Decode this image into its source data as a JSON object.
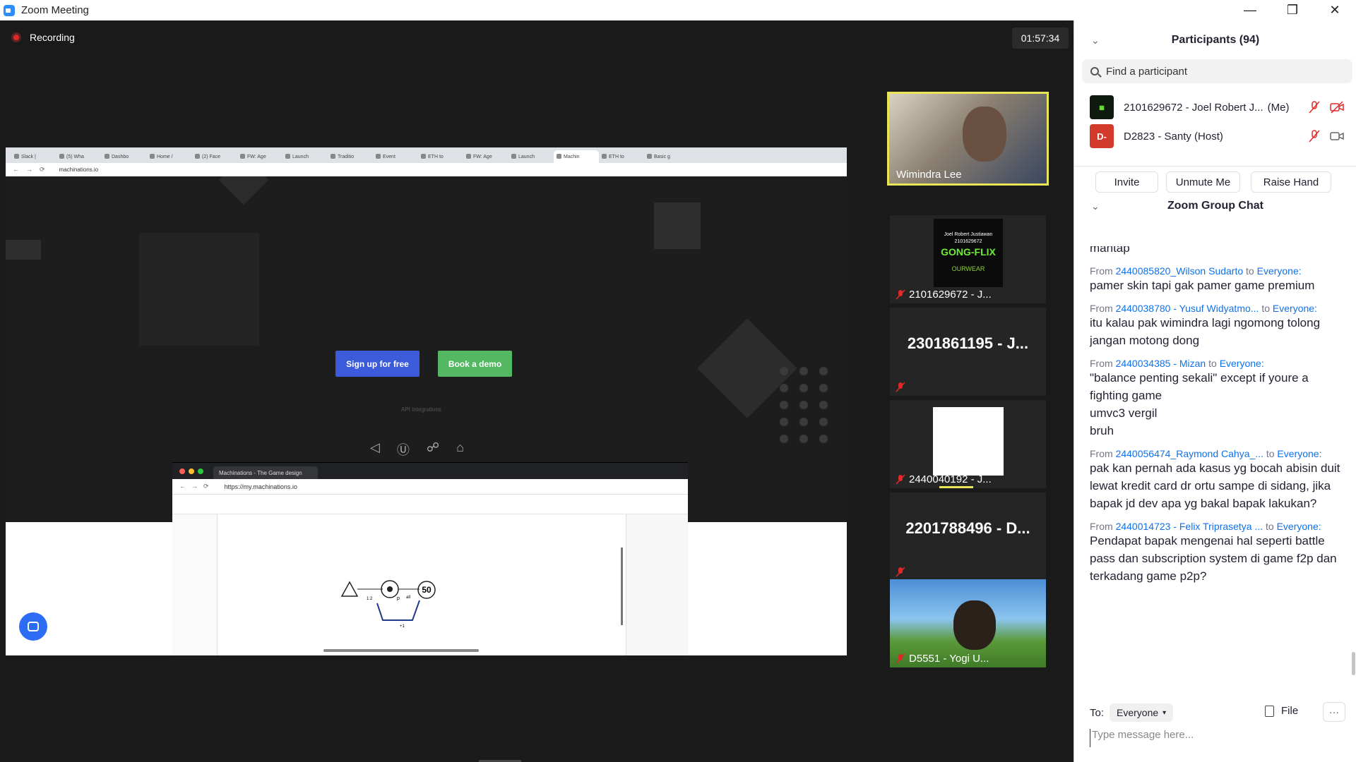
{
  "window": {
    "title": "Zoom Meeting",
    "controls": {
      "minimize": "—",
      "maximize": "❐",
      "close": "✕"
    }
  },
  "meeting": {
    "recording_label": "Recording",
    "timer": "01:57:34"
  },
  "shared_screen": {
    "browser_tabs": [
      "Slack | ",
      "(5) Wha",
      "Dashbo",
      "Home /",
      "(2) Face",
      "FW: Age",
      "Launch",
      "Traditio",
      "Event",
      "ETH to",
      "FW: Age",
      "Launch",
      "Machin",
      "ETH to",
      "Basic g"
    ],
    "url": "machinations.io",
    "signup_button": "Sign up for free",
    "demo_button": "Book a demo",
    "api_label": "API Integrations",
    "inner_window": {
      "tab_title": "Machinations - The Game design",
      "url": "https://my.machinations.io",
      "diagram_value": "50",
      "diagram_labels": [
        "1:2",
        "p",
        "all",
        "+1"
      ]
    }
  },
  "tiles": [
    {
      "name": "Wimindra Lee",
      "active": true,
      "muted": false
    },
    {
      "name": "2101629672 - J...",
      "muted": true,
      "poster": {
        "line1": "Joel Robert Justiawan",
        "line2": "2101629672",
        "brand": "GONG-FLIX",
        "footer": "OURWEAR"
      }
    },
    {
      "name": "2301861195 - J...",
      "muted": true
    },
    {
      "name": "2440040192 - J...",
      "muted": true
    },
    {
      "name": "2201788496 - D...",
      "muted": true
    },
    {
      "name": "D5551 - Yogi U...",
      "muted": true
    }
  ],
  "panel": {
    "participants_header": "Participants (94)",
    "search_placeholder": "Find a participant",
    "participants": [
      {
        "name": "2101629672 - Joel Robert J...",
        "tag": "(Me)"
      },
      {
        "name": "D2823 - Santy (Host)",
        "avatar": "D-"
      }
    ],
    "buttons": {
      "invite": "Invite",
      "unmute": "Unmute Me",
      "raise": "Raise Hand"
    },
    "chat_header": "Zoom Group Chat",
    "chat": {
      "first_text": "mantap",
      "messages": [
        {
          "from_label": "From",
          "from": "2440085820_Wilson Sudarto",
          "to_label": "to",
          "to": "Everyone:",
          "text": "pamer skin tapi gak pamer game premium"
        },
        {
          "from_label": "From",
          "from": "2440038780 - Yusuf Widyatmo...",
          "to_label": "to",
          "to": "Everyone:",
          "text": "itu kalau pak wimindra lagi ngomong tolong jangan motong dong"
        },
        {
          "from_label": "From",
          "from": "2440034385 - Mizan",
          "to_label": "to",
          "to": "Everyone:",
          "text": "\"balance penting sekali\" except if youre a fighting game\numvc3 vergil\nbruh"
        },
        {
          "from_label": "From",
          "from": "2440056474_Raymond Cahya_...",
          "to_label": "to",
          "to": "Everyone:",
          "text": "pak kan pernah ada kasus yg bocah abisin duit lewat kredit card dr ortu sampe di sidang, jika bapak jd dev apa yg bakal bapak lakukan?"
        },
        {
          "from_label": "From",
          "from": "2440014723 - Felix Triprasetya ...",
          "to_label": "to",
          "to": "Everyone:",
          "text": "Pendapat bapak mengenai hal seperti battle pass dan subscription system di game f2p dan terkadang game p2p?"
        }
      ]
    },
    "to_label": "To:",
    "to_value": "Everyone",
    "file_label": "File",
    "more_label": "···",
    "input_placeholder": "Type message here..."
  }
}
